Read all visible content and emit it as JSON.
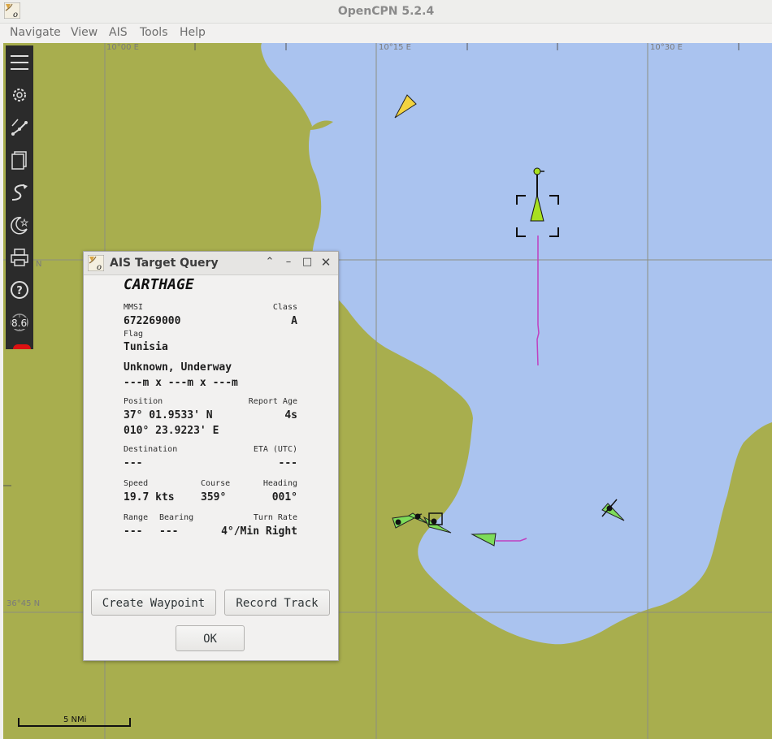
{
  "window": {
    "title": "OpenCPN 5.2.4"
  },
  "menu": {
    "items": [
      "Navigate",
      "View",
      "AIS",
      "Tools",
      "Help"
    ]
  },
  "chart": {
    "grid_labels": {
      "lon_1000": "10°00 E",
      "lon_1015": "10°15 E",
      "lon_1030": "10°30 E",
      "lat_n": "N",
      "lat_3645": "36°45 N"
    },
    "scale": "5 NMi",
    "compass_value": "8.6",
    "colors": {
      "land": "#a8ae4e",
      "water": "#aac3ef",
      "grid": "#8c8f80",
      "track": "#c040c0",
      "ais_target": "#7ddc5a",
      "selected_target": "#a8e020",
      "ais_class_b": "#f2d340"
    }
  },
  "toolbar": {
    "buttons": [
      {
        "icon": "menu-icon"
      },
      {
        "icon": "settings-icon"
      },
      {
        "icon": "route-icon"
      },
      {
        "icon": "layers-icon"
      },
      {
        "icon": "track-icon"
      },
      {
        "icon": "night-mode-icon"
      },
      {
        "icon": "print-icon"
      },
      {
        "icon": "help-icon"
      },
      {
        "icon": "compass-icon"
      }
    ]
  },
  "dialog": {
    "title": "AIS Target Query",
    "ship_name": "CARTHAGE",
    "mmsi_label": "MMSI",
    "mmsi": "672269000",
    "class_label": "Class",
    "class": "A",
    "flag_label": "Flag",
    "flag": "Tunisia",
    "status": "Unknown, Underway",
    "dimensions": "---m x ---m x ---m",
    "position_label": "Position",
    "position_lat": "37° 01.9533' N",
    "position_lon": "010° 23.9223' E",
    "report_age_label": "Report Age",
    "report_age": "4s",
    "destination_label": "Destination",
    "destination": "---",
    "eta_label": "ETA (UTC)",
    "eta": "---",
    "speed_label": "Speed",
    "speed": "19.7 kts",
    "course_label": "Course",
    "course": "359°",
    "heading_label": "Heading",
    "heading": "001°",
    "range_label": "Range",
    "range": "---",
    "bearing_label": "Bearing",
    "bearing": "---",
    "turn_rate_label": "Turn Rate",
    "turn_rate": "4°/Min Right",
    "create_waypoint_label": "Create Waypoint",
    "record_track_label": "Record Track",
    "ok_label": "OK"
  }
}
